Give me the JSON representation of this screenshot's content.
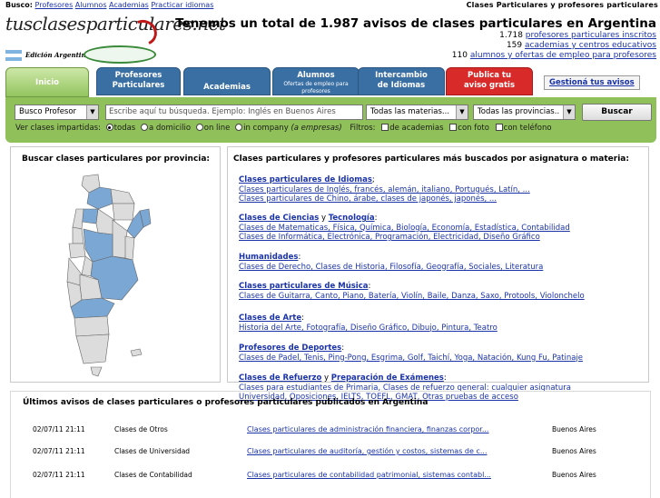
{
  "topbar": {
    "busco_label": "Busco:",
    "links": [
      "Profesores",
      "Alumnos",
      "Academias",
      "Practicar idiomas"
    ],
    "right": "Clases Particulares y profesores particulares"
  },
  "brand": {
    "logo": "tusclasesparticulares.net",
    "edition": "Edición Argentina",
    "flag_colors": [
      "#7fb3e0",
      "#ffffff"
    ]
  },
  "header": {
    "title": "Tenemos un total de 1.987 avisos de clases particulares en Argentina",
    "stats": [
      {
        "num": "1.718",
        "text": "profesores particulares inscritos"
      },
      {
        "num": "159",
        "text": "academias y centros educativos"
      },
      {
        "num": "110",
        "text": "alumnos y ofertas de empleo para profesores"
      }
    ]
  },
  "tabs": [
    {
      "label": "Inicio",
      "sub": ""
    },
    {
      "label": "Profesores\nParticulares",
      "sub": ""
    },
    {
      "label": "Academias",
      "sub": ""
    },
    {
      "label": "Alumnos",
      "sub": "Ofertas de empleo para profesores"
    },
    {
      "label": "Intercambio\nde Idiomas",
      "sub": ""
    },
    {
      "label": "Publica tu\naviso gratis",
      "sub": ""
    }
  ],
  "gestiona": "Gestioná tus avisos",
  "search": {
    "type": "Busco Profesor",
    "placeholder": "Escribe aquí tu búsqueda. Ejemplo: Inglés en Buenos Aires",
    "materias": "Todas las materias...",
    "provincias": "Todas las provincias..",
    "button": "Buscar",
    "ver_label": "Ver clases impartidas:",
    "radios": [
      "todas",
      "a domicilio",
      "on line",
      "in company"
    ],
    "in_company_note": "(a empresas)",
    "filtros_label": "Filtros:",
    "checks": [
      "de academias",
      "con foto",
      "con teléfono"
    ]
  },
  "left": {
    "title": "Buscar clases particulares por provincia:"
  },
  "right": {
    "title": "Clases particulares y profesores particulares más buscados por asignatura o materia:",
    "cats": [
      {
        "head": "Clases particulares de Idiomas",
        "head2": "",
        "tail": ";",
        "lines": [
          "Clases particulares de Inglés, francés, alemán, italiano, Portugués, Latín, ...",
          "Clases particulares de Chino, árabe, clases de japonés, japonés, ..."
        ]
      },
      {
        "head": "Clases de Ciencias",
        "head2": "Tecnología",
        "tail": ":",
        "lines": [
          "Clases de Matematicas, Física, Química, Biología, Economía, Estadística, Contabilidad",
          "Clases de Informática, Electrónica, Programación, Electricidad, Diseño Gráfico"
        ]
      },
      {
        "head": "Humanidades",
        "head2": "",
        "tail": ":",
        "lines": [
          "Clases de Derecho, Clases de Historia, Filosofía, Geografía, Sociales, Literatura"
        ]
      },
      {
        "head": "Clases particulares de Música",
        "head2": "",
        "tail": ":",
        "lines": [
          "Clases de Guitarra, Canto, Piano, Batería, Violín, Baile, Danza, Saxo, Protools, Violonchelo"
        ]
      },
      {
        "head": "Clases de Arte",
        "head2": "",
        "tail": ":",
        "lines": [
          "Historia del Arte, Fotografía, Diseño Gráfico, Dibujo, Pintura, Teatro"
        ]
      },
      {
        "head": "Profesores de Deportes",
        "head2": "",
        "tail": ":",
        "lines": [
          "Clases de Padel, Tenis, Ping-Pong, Esgrima, Golf, Taichí, Yoga, Natación, Kung Fu, Patinaje"
        ]
      },
      {
        "head": "Clases de Refuerzo",
        "head2": "Preparación de Exámenes",
        "tail": ":",
        "lines": [
          "Clases para estudiantes de Primaria, Clases de refuerzo general: cualquier asignatura",
          "Universidad, Oposiciones, IELTS, TOEFL, GMAT, Otras pruebas de acceso"
        ]
      }
    ]
  },
  "bottom": {
    "title": "Últimos avisos de clases particulares o profesores particulares publicados en Argentina",
    "rows": [
      {
        "date": "02/07/11 21:11",
        "cat": "Clases de Otros",
        "title": "Clases particulares de administración financiera, finanzas corpor...",
        "place": "Buenos Aires"
      },
      {
        "date": "02/07/11 21:11",
        "cat": "Clases de Universidad",
        "title": "Clases particulares de auditoría, gestión y costos, sistemas de c...",
        "place": "Buenos Aires"
      },
      {
        "date": "02/07/11 21:11",
        "cat": "Clases de Contabilidad",
        "title": "Clases particulares de contabilidad patrimonial, sistemas contabl...",
        "place": "Buenos Aires"
      }
    ]
  },
  "colors": {
    "accent_green": "#8fc05a",
    "tab_blue": "#3a6fa3",
    "tab_red": "#d92a2a",
    "link": "#1a33a8"
  }
}
